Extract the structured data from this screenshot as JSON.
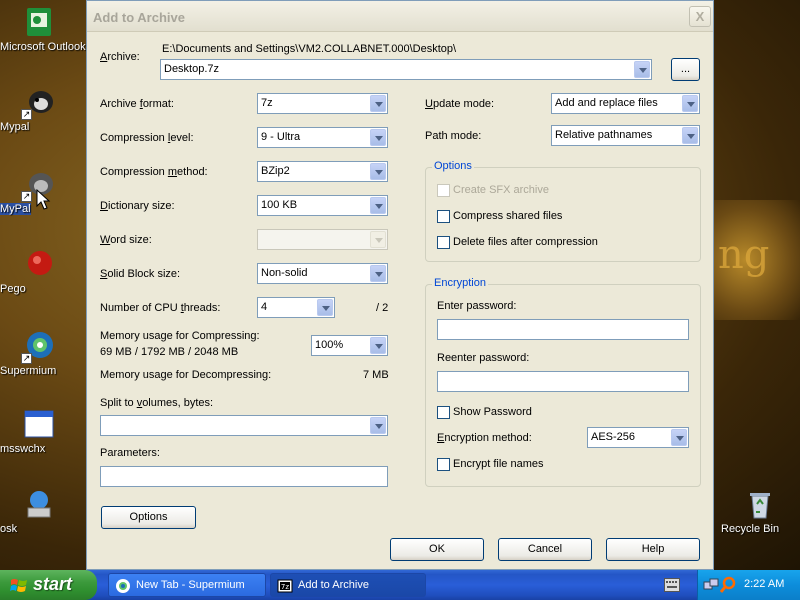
{
  "desktop": {
    "icons": [
      {
        "label": "Microsoft Outlook"
      },
      {
        "label": "Mypal"
      },
      {
        "label": "MyPal"
      },
      {
        "label": "Pego"
      },
      {
        "label": "Supermium"
      },
      {
        "label": "msswchx"
      },
      {
        "label": "osk"
      },
      {
        "label": "Recycle Bin"
      }
    ],
    "background_glyph": "ng"
  },
  "dialog": {
    "title": "Add to Archive",
    "close": "X",
    "archive": {
      "label": "Archive:",
      "path": "E:\\Documents and Settings\\VM2.COLLABNET.000\\Desktop\\",
      "value": "Desktop.7z",
      "browse": "..."
    },
    "left": {
      "format_label": "Archive format:",
      "format_value": "7z",
      "level_label": "Compression level:",
      "level_value": "9 - Ultra",
      "method_label": "Compression method:",
      "method_value": "BZip2",
      "dict_label": "Dictionary size:",
      "dict_value": "100 KB",
      "word_label": "Word size:",
      "word_value": "",
      "solid_label": "Solid Block size:",
      "solid_value": "Non-solid",
      "cpu_label": "Number of CPU threads:",
      "cpu_value": "4",
      "cpu_max": "/ 2",
      "mem_comp_label": "Memory usage for Compressing:",
      "mem_comp_values": "69 MB / 1792 MB / 2048 MB",
      "mem_comp_pct": "100%",
      "mem_decomp_label": "Memory usage for Decompressing:",
      "mem_decomp_value": "7 MB",
      "split_label": "Split to volumes, bytes:",
      "split_value": "",
      "params_label": "Parameters:",
      "params_value": "",
      "options_button": "Options"
    },
    "right": {
      "update_label": "Update mode:",
      "update_value": "Add and replace files",
      "path_label": "Path mode:",
      "path_value": "Relative pathnames",
      "options_group": "Options",
      "sfx_label": "Create SFX archive",
      "shared_label": "Compress shared files",
      "delete_label": "Delete files after compression",
      "encryption_group": "Encryption",
      "enter_pw_label": "Enter password:",
      "reenter_pw_label": "Reenter password:",
      "show_pw_label": "Show Password",
      "enc_method_label": "Encryption method:",
      "enc_method_value": "AES-256",
      "enc_names_label": "Encrypt file names"
    },
    "buttons": {
      "ok": "OK",
      "cancel": "Cancel",
      "help": "Help"
    }
  },
  "taskbar": {
    "start": "start",
    "items": [
      {
        "label": "New Tab - Supermium"
      },
      {
        "label": "Add to Archive"
      }
    ],
    "clock": "2:22 AM"
  }
}
